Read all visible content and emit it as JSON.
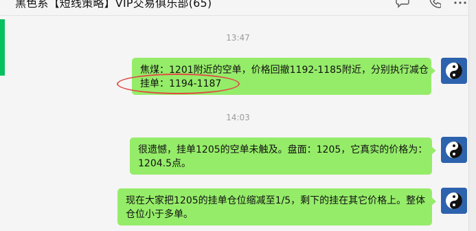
{
  "window": {
    "title": "黑色系【短线策略】VIP交易俱乐部(65)",
    "icons": [
      "chat-bubble-icon",
      "phone-icon",
      "more-icon"
    ]
  },
  "messages": [
    {
      "time": "13:47",
      "lines": [
        "焦煤：1201附近的空单，价格回撤1192-1185附近，分别执行减仓",
        "挂单：1194-1187"
      ],
      "sender_avatar": "taiji-icon"
    },
    {
      "time": "14:03",
      "lines": [
        "很遗憾，挂单1205的空单未触及。盘面：1205，它真实的价格为：",
        "1204.5点。"
      ],
      "sender_avatar": "taiji-icon"
    },
    {
      "time": "",
      "lines": [
        "现在大家把1205的挂单仓位缩减至1/5，剩下的挂在其它价格上。整体",
        "仓位小于多单。"
      ],
      "sender_avatar": "taiji-icon"
    }
  ],
  "annotation": {
    "color": "#e04a44",
    "shape": "ellipse"
  },
  "colors": {
    "bubble": "#95ec69",
    "accent": "#07c160",
    "background": "#f5f5f5"
  }
}
